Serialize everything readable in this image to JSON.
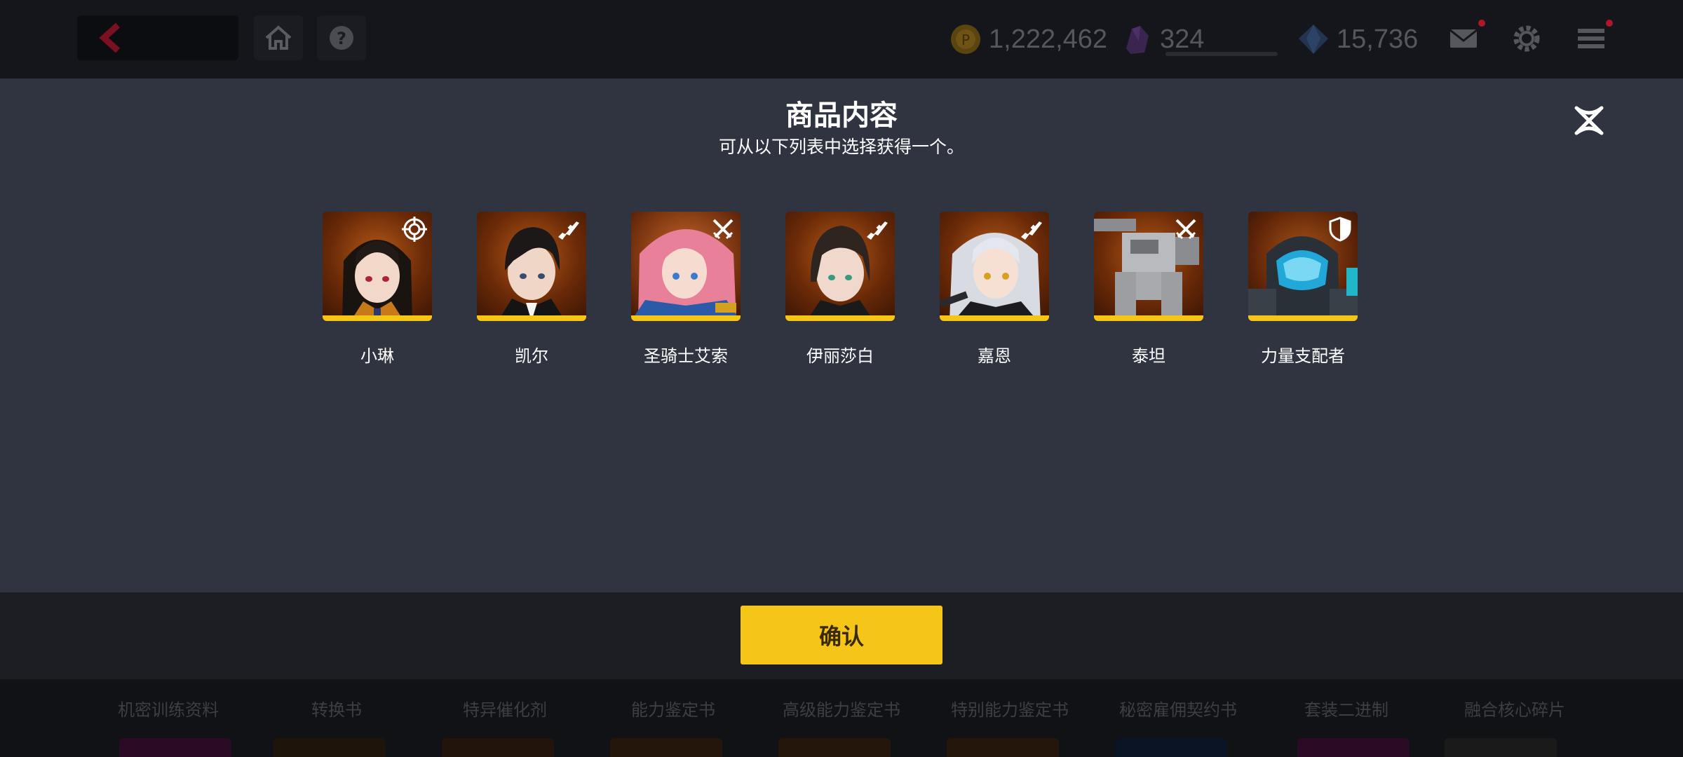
{
  "topbar": {
    "resources": [
      {
        "icon": "gold-coin-icon",
        "value": "1,222,462"
      },
      {
        "icon": "purple-crystal-icon",
        "value": "324"
      },
      {
        "icon": "blue-diamond-icon",
        "value": "15,736"
      }
    ]
  },
  "modal": {
    "title": "商品内容",
    "subtitle": "可从以下列表中选择获得一个。",
    "items": [
      {
        "name": "小琳",
        "role_icon": "crosshair-icon"
      },
      {
        "name": "凯尔",
        "role_icon": "rifle-icon"
      },
      {
        "name": "圣骑士艾索",
        "role_icon": "crossed-swords-icon"
      },
      {
        "name": "伊丽莎白",
        "role_icon": "rifle-icon"
      },
      {
        "name": "嘉恩",
        "role_icon": "rifle-icon"
      },
      {
        "name": "泰坦",
        "role_icon": "crossed-swords-icon"
      },
      {
        "name": "力量支配者",
        "role_icon": "shield-icon"
      }
    ],
    "confirm_label": "确认"
  },
  "tabs": [
    "机密训练资料",
    "转换书",
    "特异催化剂",
    "能力鉴定书",
    "高级能力鉴定书",
    "特别能力鉴定书",
    "秘密雇佣契约书",
    "套装二进制",
    "融合核心碎片"
  ],
  "colors": {
    "accent": "#f5c518",
    "modal_bg": "#2f3440",
    "footer_bg": "#1c1e24"
  }
}
